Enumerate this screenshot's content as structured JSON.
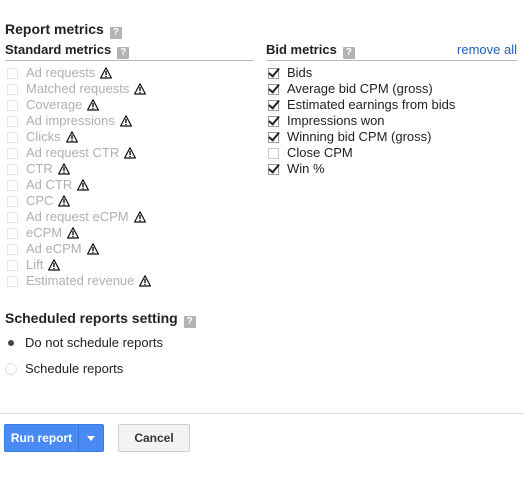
{
  "report_metrics": {
    "title": "Report metrics",
    "help": "?"
  },
  "standard_metrics": {
    "title": "Standard metrics",
    "help": "?",
    "items": [
      {
        "label": "Ad requests",
        "checked": false,
        "disabled": true,
        "warning": true
      },
      {
        "label": "Matched requests",
        "checked": false,
        "disabled": true,
        "warning": true
      },
      {
        "label": "Coverage",
        "checked": false,
        "disabled": true,
        "warning": true
      },
      {
        "label": "Ad impressions",
        "checked": false,
        "disabled": true,
        "warning": true
      },
      {
        "label": "Clicks",
        "checked": false,
        "disabled": true,
        "warning": true
      },
      {
        "label": "Ad request CTR",
        "checked": false,
        "disabled": true,
        "warning": true
      },
      {
        "label": "CTR",
        "checked": false,
        "disabled": true,
        "warning": true
      },
      {
        "label": "Ad CTR",
        "checked": false,
        "disabled": true,
        "warning": true
      },
      {
        "label": "CPC",
        "checked": false,
        "disabled": true,
        "warning": true
      },
      {
        "label": "Ad request eCPM",
        "checked": false,
        "disabled": true,
        "warning": true
      },
      {
        "label": "eCPM",
        "checked": false,
        "disabled": true,
        "warning": true
      },
      {
        "label": "Ad eCPM",
        "checked": false,
        "disabled": true,
        "warning": true
      },
      {
        "label": "Lift",
        "checked": false,
        "disabled": true,
        "warning": true
      },
      {
        "label": "Estimated revenue",
        "checked": false,
        "disabled": true,
        "warning": true
      }
    ]
  },
  "bid_metrics": {
    "title": "Bid metrics",
    "help": "?",
    "remove_all": "remove all",
    "items": [
      {
        "label": "Bids",
        "checked": true
      },
      {
        "label": "Average bid CPM (gross)",
        "checked": true
      },
      {
        "label": "Estimated earnings from bids",
        "checked": true
      },
      {
        "label": "Impressions won",
        "checked": true
      },
      {
        "label": "Winning bid CPM (gross)",
        "checked": true
      },
      {
        "label": "Close CPM",
        "checked": false
      },
      {
        "label": "Win %",
        "checked": true
      }
    ]
  },
  "scheduled": {
    "title": "Scheduled reports setting",
    "help": "?",
    "options": [
      {
        "label": "Do not schedule reports",
        "selected": true
      },
      {
        "label": "Schedule reports",
        "selected": false
      }
    ]
  },
  "actions": {
    "run_label": "Run report",
    "cancel_label": "Cancel"
  },
  "colors": {
    "accent": "#4a8af4",
    "link": "#1f5dbb",
    "disabled_text": "#b0b0b0"
  }
}
